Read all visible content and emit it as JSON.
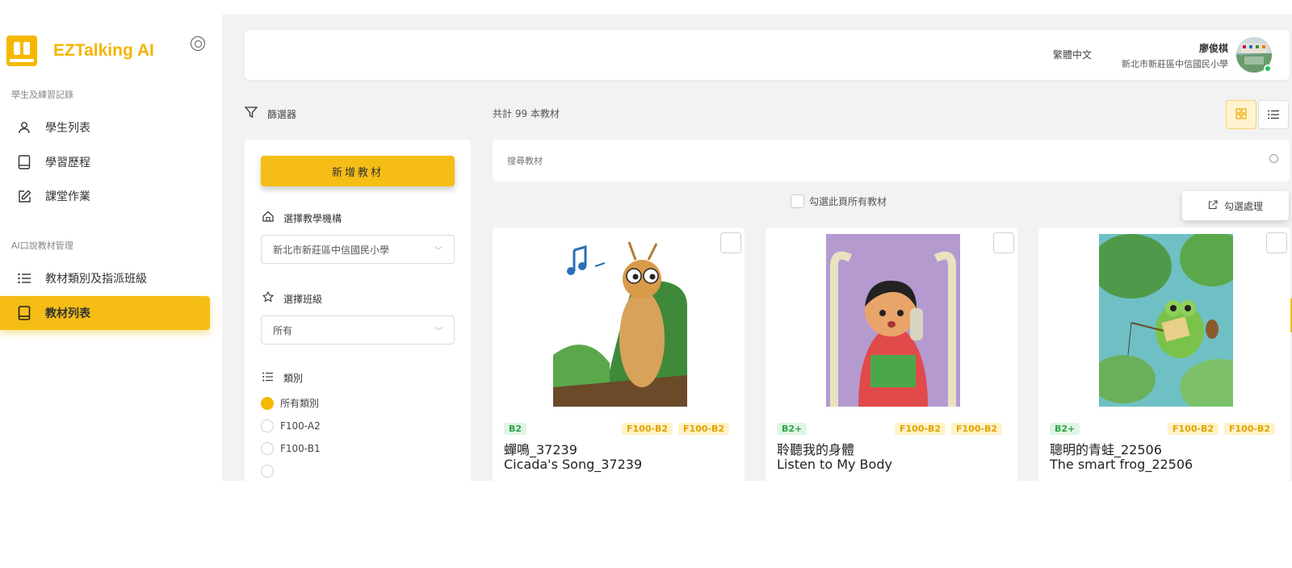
{
  "brand": {
    "name": "EZTalking AI"
  },
  "sidebar": {
    "section1": "學生及練習記錄",
    "section2": "AI口說教材管理",
    "items": [
      {
        "label": "學生列表",
        "icon": "user-icon"
      },
      {
        "label": "學習歷程",
        "icon": "book-icon"
      },
      {
        "label": "課堂作業",
        "icon": "edit-icon"
      },
      {
        "label": "教材類別及指派班級",
        "icon": "list-icon"
      },
      {
        "label": "教材列表",
        "icon": "book-icon",
        "active": true
      }
    ]
  },
  "header": {
    "language": "繁體中文",
    "user_name": "廖俊棋",
    "user_school": "新北市新莊區中信國民小學"
  },
  "filter": {
    "title": "篩選器",
    "add_button": "新增教材",
    "institution_label": "選擇教學機構",
    "institution_value": "新北市新莊區中信國民小學",
    "class_label": "選擇班級",
    "class_value": "所有",
    "category_label": "類別",
    "categories": [
      {
        "label": "所有類別",
        "selected": true
      },
      {
        "label": "F100-A2",
        "selected": false
      },
      {
        "label": "F100-B1",
        "selected": false
      }
    ]
  },
  "main": {
    "total_count": "共計 99 本教材",
    "search_placeholder": "搜尋教材",
    "select_all_label": "勾選此頁所有教材",
    "batch_button": "勾選處理"
  },
  "cards": [
    {
      "level": "B2",
      "tags": [
        "F100-B2",
        "F100-B2"
      ],
      "title": "蟬鳴_37239",
      "subtitle": "Cicada's Song_37239"
    },
    {
      "level": "B2+",
      "tags": [
        "F100-B2",
        "F100-B2"
      ],
      "title": "聆聽我的身體",
      "subtitle": "Listen to My Body"
    },
    {
      "level": "B2+",
      "tags": [
        "F100-B2",
        "F100-B2"
      ],
      "title": "聰明的青蛙_22506",
      "subtitle": "The smart frog_22506"
    }
  ],
  "colors": {
    "accent": "#f5bd16",
    "level_green": "#2aa548",
    "tag_yellow": "#e0a400"
  }
}
